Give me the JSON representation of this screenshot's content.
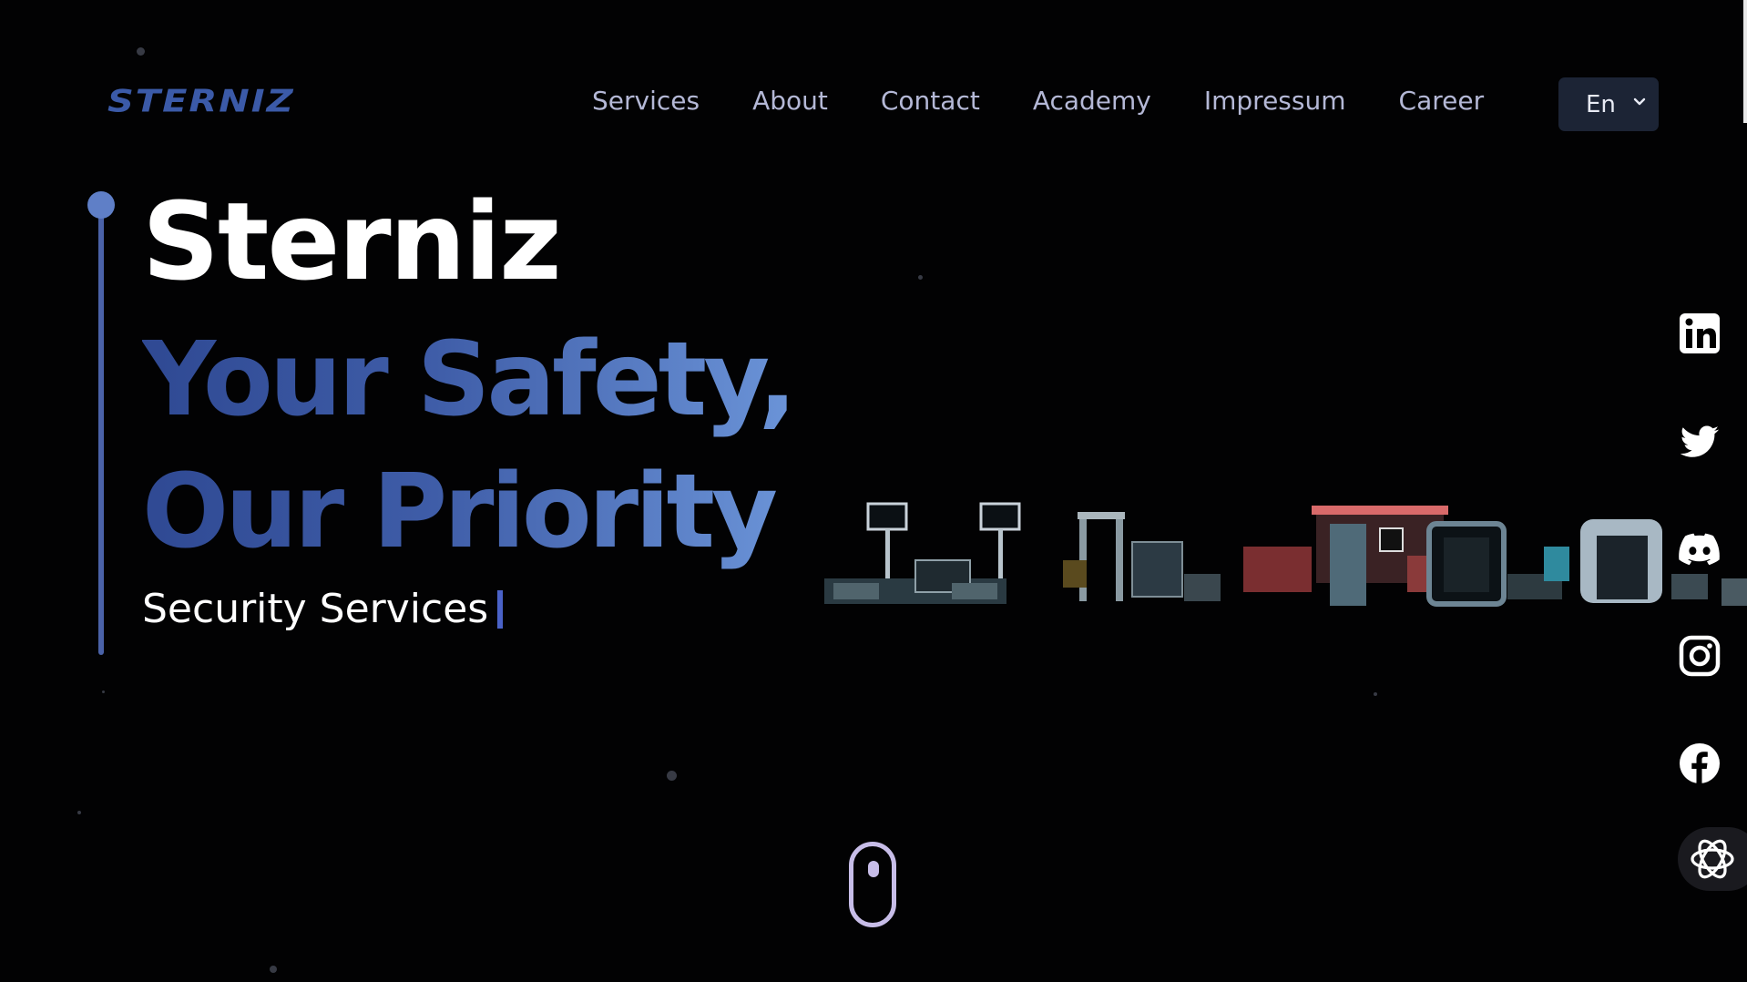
{
  "header": {
    "logo_text": "STERNIZ",
    "nav": [
      "Services",
      "About",
      "Contact",
      "Academy",
      "Impressum",
      "Career"
    ],
    "language": "En"
  },
  "hero": {
    "title": "Sterniz",
    "subtitle_line1": "Your Safety,",
    "subtitle_line2": "Our Priority",
    "typed_text": "Security Services"
  },
  "socials": [
    "linkedin-icon",
    "twitter-icon",
    "discord-icon",
    "instagram-icon",
    "facebook-icon",
    "openai-icon"
  ],
  "colors": {
    "background": "#020203",
    "accent": "#3b5aa8",
    "nav_text": "#b4b8d6",
    "gradient_start": "#2f4993",
    "gradient_end": "#6b94d8"
  }
}
